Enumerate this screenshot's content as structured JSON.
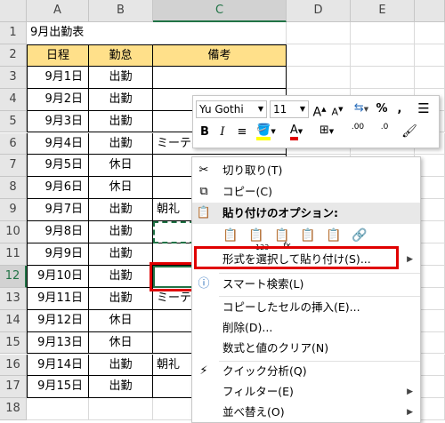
{
  "columns": [
    "A",
    "B",
    "C",
    "D",
    "E"
  ],
  "rows": [
    "1",
    "2",
    "3",
    "4",
    "5",
    "6",
    "7",
    "8",
    "9",
    "10",
    "11",
    "12",
    "13",
    "14",
    "15",
    "16",
    "17",
    "18"
  ],
  "title_cell": "9月出勤表",
  "headers": {
    "date": "日程",
    "status": "勤怠",
    "note": "備考"
  },
  "data_rows": [
    {
      "date": "9月1日",
      "status": "出勤",
      "note": ""
    },
    {
      "date": "9月2日",
      "status": "出勤",
      "note": ""
    },
    {
      "date": "9月3日",
      "status": "出勤",
      "note": ""
    },
    {
      "date": "9月4日",
      "status": "出勤",
      "note": "ミーティング"
    },
    {
      "date": "9月5日",
      "status": "休日",
      "note": ""
    },
    {
      "date": "9月6日",
      "status": "休日",
      "note": ""
    },
    {
      "date": "9月7日",
      "status": "出勤",
      "note": "朝礼"
    },
    {
      "date": "9月8日",
      "status": "出勤",
      "note": ""
    },
    {
      "date": "9月9日",
      "status": "出勤",
      "note": ""
    },
    {
      "date": "9月10日",
      "status": "出勤",
      "note": ""
    },
    {
      "date": "9月11日",
      "status": "出勤",
      "note": "ミーティング"
    },
    {
      "date": "9月12日",
      "status": "休日",
      "note": ""
    },
    {
      "date": "9月13日",
      "status": "休日",
      "note": ""
    },
    {
      "date": "9月14日",
      "status": "出勤",
      "note": "朝礼"
    },
    {
      "date": "9月15日",
      "status": "出勤",
      "note": ""
    }
  ],
  "mini_toolbar": {
    "font_name": "Yu Gothi",
    "font_size": "11",
    "bold": "B",
    "italic": "I",
    "percent": "%",
    "comma": ",",
    "inc_font": "A",
    "dec_font": "A",
    "font_color_letter": "A",
    "dec_inc": ".00",
    "dec_dec": ".0"
  },
  "menu": {
    "cut": "切り取り(T)",
    "copy": "コピー(C)",
    "paste_options": "貼り付けのオプション:",
    "paste_special": "形式を選択して貼り付け(S)...",
    "smart_lookup": "スマート検索(L)",
    "insert_copied": "コピーしたセルの挿入(E)...",
    "delete": "削除(D)...",
    "clear": "数式と値のクリア(N)",
    "quick_analysis": "クイック分析(Q)",
    "filter": "フィルター(E)",
    "sort": "並べ替え(O)"
  },
  "highlight_color": "#e00000",
  "header_fill": "#ffe08a",
  "selection_color": "#217346"
}
